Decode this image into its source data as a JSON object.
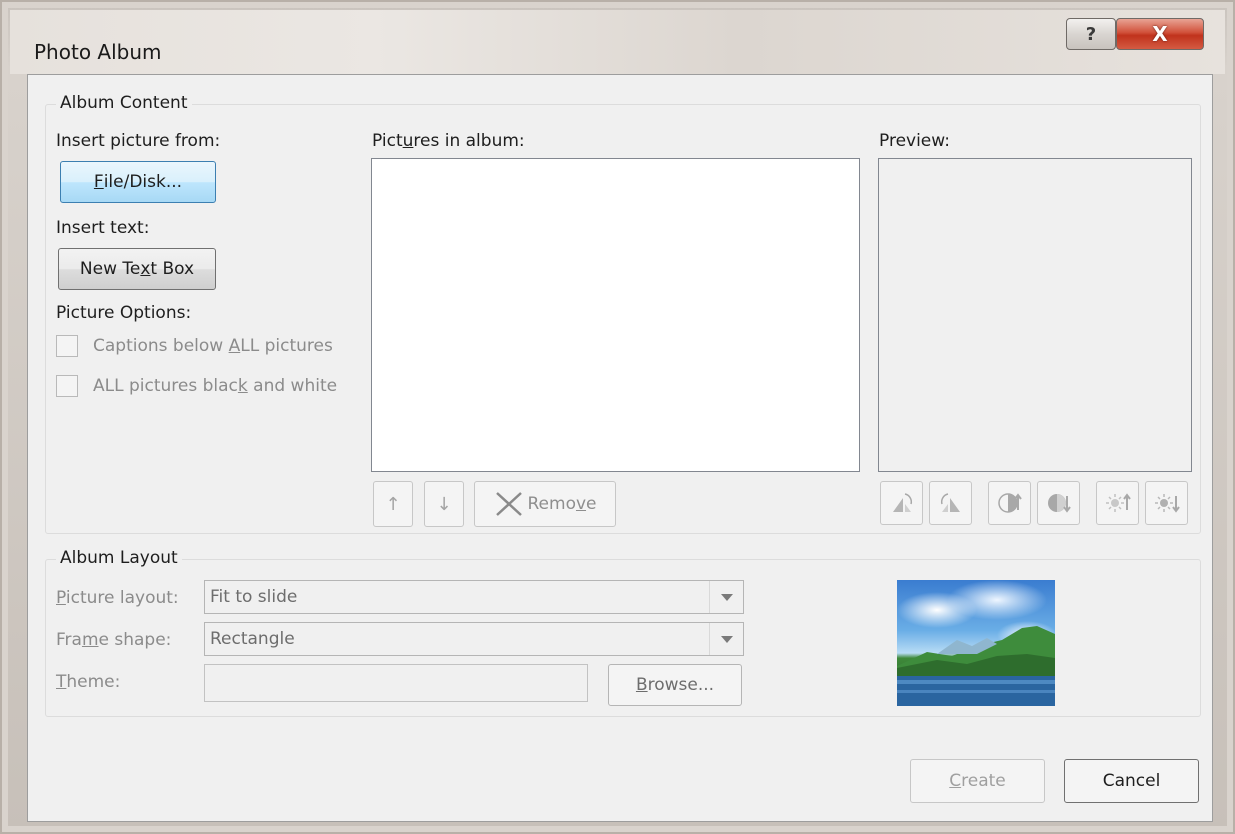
{
  "window": {
    "title": "Photo Album",
    "help_glyph": "?",
    "close_glyph": "X"
  },
  "album_content": {
    "group_label": "Album Content",
    "insert_picture_label": "Insert picture from:",
    "file_disk_button": {
      "pre": "",
      "key": "F",
      "post": "ile/Disk..."
    },
    "insert_text_label": "Insert text:",
    "new_text_box_button": {
      "pre": "New Te",
      "key": "x",
      "post": "t Box"
    },
    "picture_options_label": "Picture Options:",
    "captions_option": {
      "pre": "Captions below ",
      "key": "A",
      "post": "LL pictures",
      "checked": false,
      "enabled": false
    },
    "bw_option": {
      "pre": "ALL pictures blac",
      "key": "k",
      "post": " and white",
      "checked": false,
      "enabled": false
    },
    "pictures_in_album_label": {
      "pre": "Pict",
      "key": "u",
      "post": "res in album:"
    },
    "pictures": [],
    "move_up_glyph": "↑",
    "move_down_glyph": "↓",
    "remove_button": {
      "pre": "Remo",
      "key": "v",
      "post": "e"
    },
    "preview_label": "Preview:"
  },
  "album_layout": {
    "group_label": "Album Layout",
    "picture_layout_label": {
      "pre": "",
      "key": "P",
      "post": "icture layout:"
    },
    "picture_layout_value": "Fit to slide",
    "frame_shape_label": {
      "pre": "Fra",
      "key": "m",
      "post": "e shape:"
    },
    "frame_shape_value": "Rectangle",
    "theme_label": {
      "pre": "",
      "key": "T",
      "post": "heme:"
    },
    "theme_value": "",
    "browse_button": {
      "pre": "",
      "key": "B",
      "post": "rowse..."
    }
  },
  "footer": {
    "create_button": {
      "pre": "",
      "key": "C",
      "post": "reate"
    },
    "cancel_button": "Cancel"
  },
  "icons": {
    "close": "close-icon",
    "help": "help-icon",
    "remove": "x-icon",
    "rotate_left": "rotate-left-icon",
    "rotate_right": "rotate-right-icon",
    "contrast_up": "contrast-up-icon",
    "contrast_down": "contrast-down-icon",
    "brightness_up": "brightness-up-icon",
    "brightness_down": "brightness-down-icon"
  }
}
